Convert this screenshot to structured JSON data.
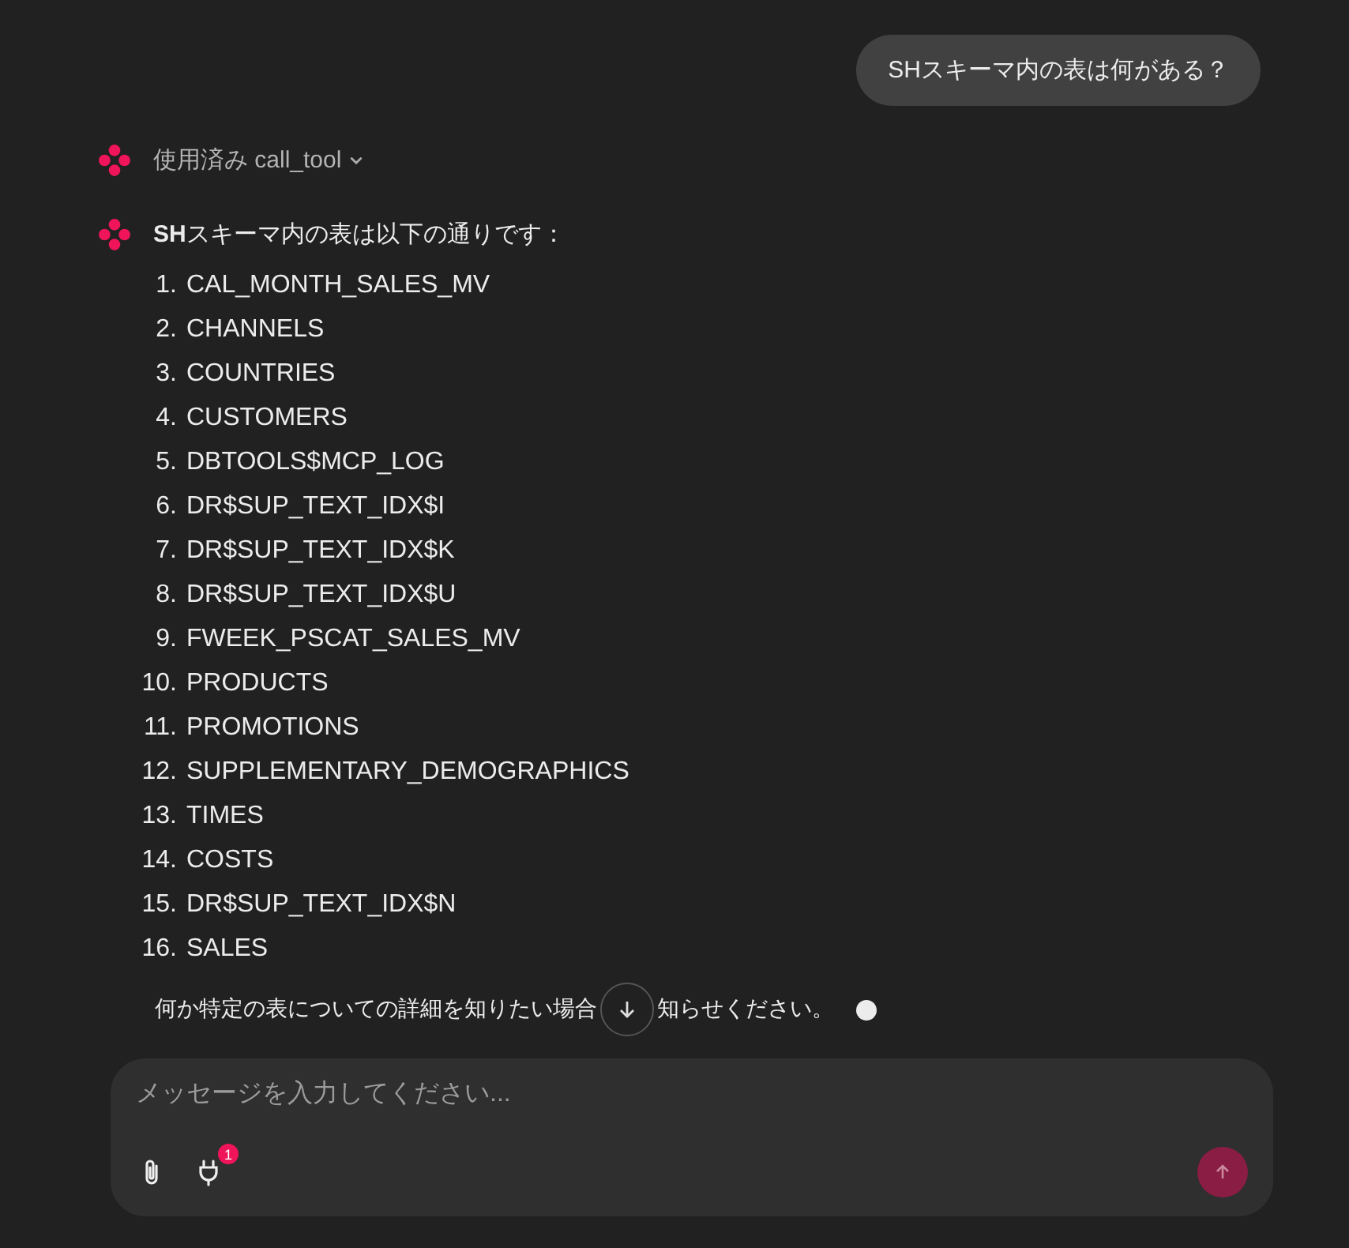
{
  "user_message": "SHスキーマ内の表は何がある？",
  "tool_call": {
    "label": "使用済み call_tool",
    "expanded": false
  },
  "answer": {
    "intro": "**SH**スキーマ内の表は以下の通りです：",
    "items": [
      "CAL_MONTH_SALES_MV",
      "CHANNELS",
      "COUNTRIES",
      "CUSTOMERS",
      "DBTOOLS$MCP_LOG",
      "DR$SUP_TEXT_IDX$I",
      "DR$SUP_TEXT_IDX$K",
      "DR$SUP_TEXT_IDX$U",
      "FWEEK_PSCAT_SALES_MV",
      "PRODUCTS",
      "PROMOTIONS",
      "SUPPLEMENTARY_DEMOGRAPHICS",
      "TIMES",
      "COSTS",
      "DR$SUP_TEXT_IDX$N",
      "SALES"
    ],
    "numbers": [
      "1.",
      "2.",
      "3.",
      "4.",
      "5.",
      "6.",
      "7.",
      "8.",
      "9.",
      "10.",
      "11.",
      "12.",
      "13.",
      "14.",
      "15.",
      "16."
    ],
    "closing_before": "何か特定の表についての詳細を知りたい場合",
    "closing_after": "知らせください。",
    "streaming": true
  },
  "composer": {
    "placeholder": "メッセージを入力してください...",
    "tools_badge": "1"
  }
}
